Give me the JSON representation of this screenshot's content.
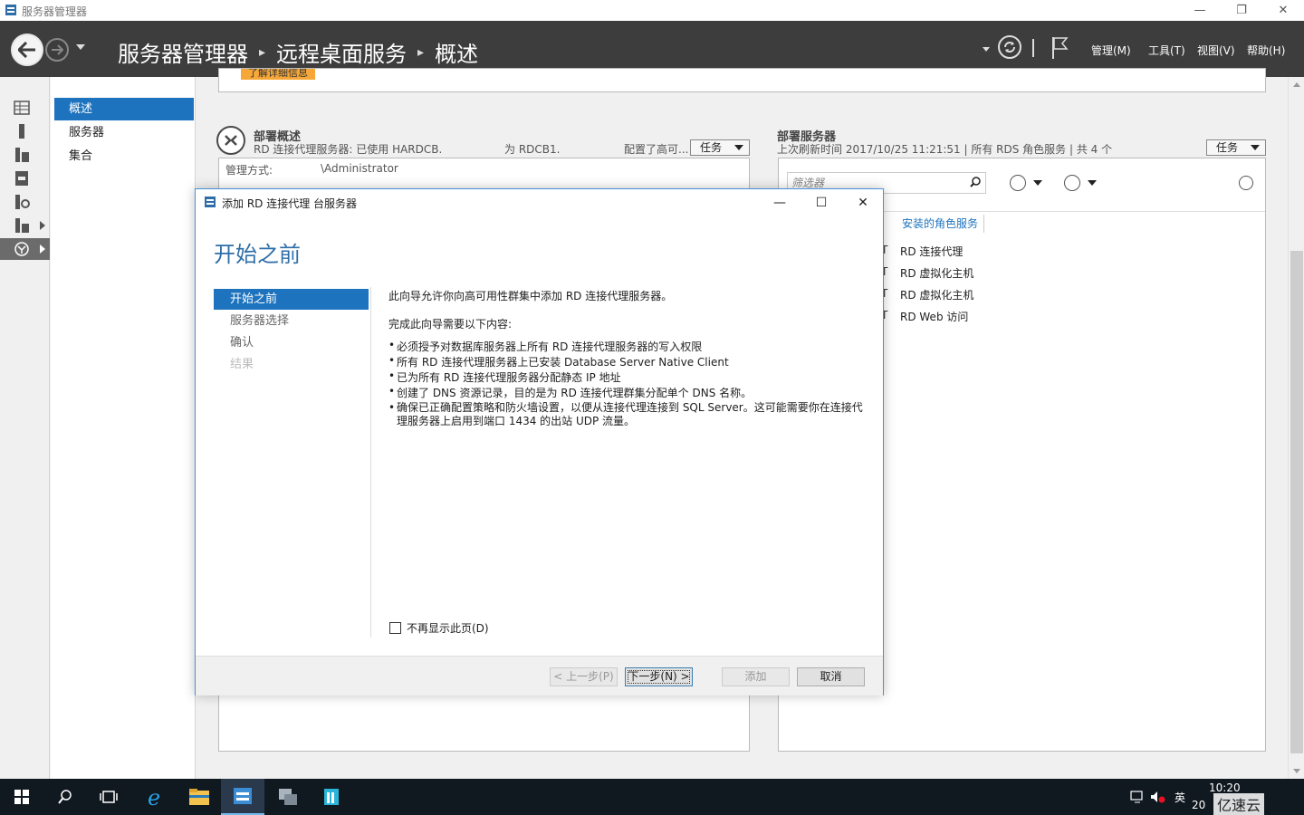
{
  "window": {
    "title": "服务器管理器"
  },
  "header": {
    "breadcrumb": [
      "服务器管理器",
      "远程桌面服务",
      "概述"
    ],
    "menus": [
      "管理(M)",
      "工具(T)",
      "视图(V)",
      "帮助(H)"
    ]
  },
  "nav": {
    "items": [
      "概述",
      "服务器",
      "集合"
    ],
    "active": 0
  },
  "content": {
    "learn_more": "了解详细信息",
    "deployment_overview": {
      "title": "部署概述",
      "subtitle_left": "RD 连接代理服务器: 已使用 HARDCB.",
      "subtitle_mid": "为 RDCB1.",
      "subtitle_right": "配置了高可...",
      "manage_as": "管理方式:",
      "manage_user": "\\Administrator",
      "task_label": "任务"
    },
    "deployment_servers": {
      "title": "部署服务器",
      "subtitle": "上次刷新时间 2017/10/25 11:21:51 | 所有 RDS 角色服务 | 共 4 个",
      "task_label": "任务",
      "filter_placeholder": "筛选器",
      "column_header": "安装的角色服务",
      "roles": [
        "RD 连接代理",
        "RD 虚拟化主机",
        "RD 虚拟化主机",
        "RD Web 访问"
      ]
    }
  },
  "dialog": {
    "title": "添加 RD 连接代理 台服务器",
    "heading": "开始之前",
    "steps": [
      {
        "label": "开始之前",
        "state": "active"
      },
      {
        "label": "服务器选择",
        "state": "normal"
      },
      {
        "label": "确认",
        "state": "normal"
      },
      {
        "label": "结果",
        "state": "disabled"
      }
    ],
    "intro": "此向导允许你向高可用性群集中添加 RD 连接代理服务器。",
    "requirements_title": "完成此向导需要以下内容:",
    "requirements": [
      "必须授予对数据库服务器上所有 RD 连接代理服务器的写入权限",
      "所有 RD 连接代理服务器上已安装 Database Server Native Client",
      "已为所有 RD 连接代理服务器分配静态 IP 地址",
      "创建了 DNS 资源记录，目的是为 RD 连接代理群集分配单个 DNS 名称。",
      "确保已正确配置策略和防火墙设置，以便从连接代理连接到 SQL Server。这可能需要你在连接代理服务器上启用到端口 1434 的出站 UDP 流量。"
    ],
    "dont_show": "不再显示此页(D)",
    "buttons": {
      "prev": "< 上一步(P)",
      "next": "下一步(N) >",
      "add": "添加",
      "cancel": "取消"
    }
  },
  "taskbar": {
    "ime": "英",
    "time": "10:20",
    "date_partial": "20"
  },
  "watermark": "亿速云"
}
